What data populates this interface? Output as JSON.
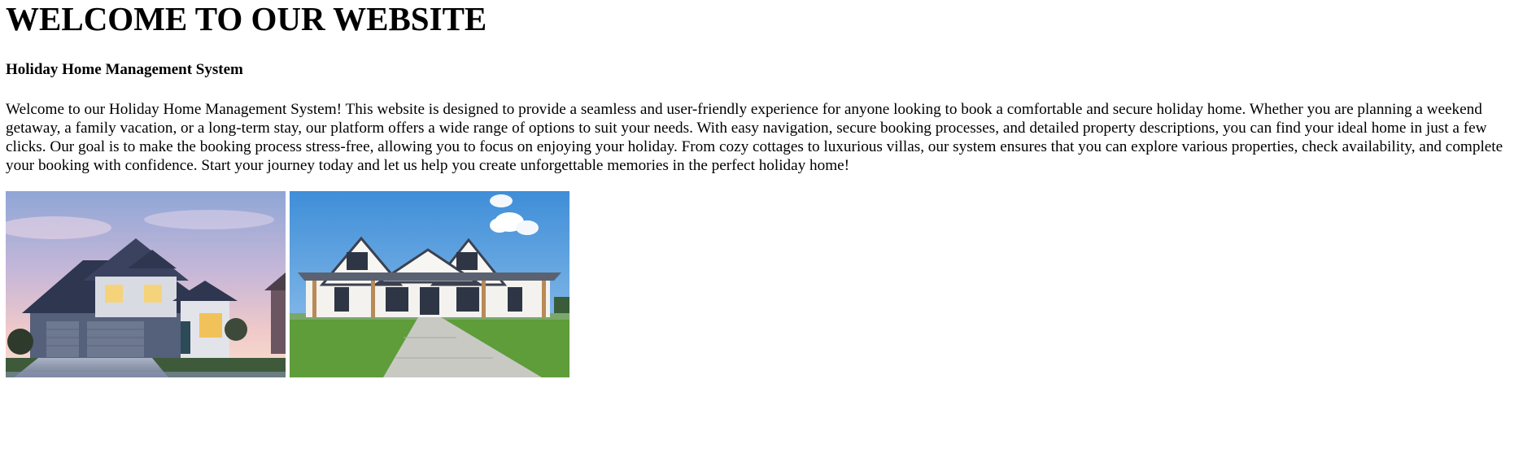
{
  "page": {
    "title": "WELCOME TO OUR WEBSITE",
    "subtitle": "Holiday Home Management System",
    "intro": "Welcome to our Holiday Home Management System! This website is designed to provide a seamless and user-friendly experience for anyone looking to book a comfortable and secure holiday home. Whether you are planning a weekend getaway, a family vacation, or a long-term stay, our platform offers a wide range of options to suit your needs. With easy navigation, secure booking processes, and detailed property descriptions, you can find your ideal home in just a few clicks. Our goal is to make the booking process stress-free, allowing you to focus on enjoying your holiday. From cozy cottages to luxurious villas, our system ensures that you can explore various properties, check availability, and complete your booking with confidence. Start your journey today and let us help you create unforgettable memories in the perfect holiday home!"
  },
  "gallery": {
    "images": [
      {
        "name": "house-photo-dusk"
      },
      {
        "name": "house-photo-farmhouse"
      }
    ]
  },
  "colors": {
    "background": "#ffffff",
    "text": "#000000"
  }
}
